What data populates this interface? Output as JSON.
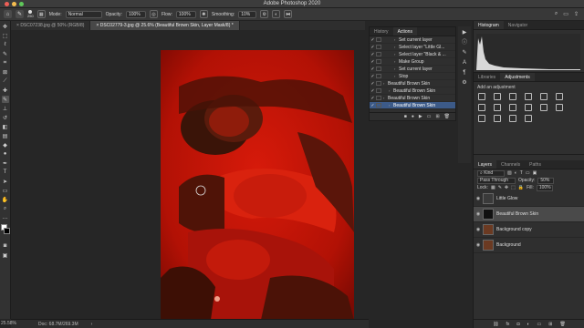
{
  "app": {
    "title": "Adobe Photoshop 2020"
  },
  "options": {
    "mode_label": "Mode:",
    "mode_value": "Normal",
    "opacity_label": "Opacity:",
    "opacity_value": "100%",
    "flow_label": "Flow:",
    "flow_value": "100%",
    "smoothing_label": "Smoothing:",
    "smoothing_value": "10%",
    "brush_size": "250"
  },
  "tabs": [
    {
      "label": "DSC07238.jpg @ 50% (RGB/8)"
    },
    {
      "label": "DSC02779-3.jpg @ 25.6% (Beautiful Brown Skin, Layer Mask/8) *"
    }
  ],
  "actions_panel": {
    "tabs": [
      "History",
      "Actions"
    ],
    "rows": [
      {
        "label": "Set current layer",
        "indent": 2,
        "selected": false
      },
      {
        "label": "Select layer \"Little Gl...",
        "indent": 2,
        "selected": false
      },
      {
        "label": "Select layer \"Black & ...",
        "indent": 2,
        "selected": false
      },
      {
        "label": "Make Group",
        "indent": 2,
        "selected": false
      },
      {
        "label": "Set current layer",
        "indent": 2,
        "selected": false
      },
      {
        "label": "Stop",
        "indent": 2,
        "selected": false
      },
      {
        "label": "Beautiful Brown Skin",
        "indent": 0,
        "selected": false
      },
      {
        "label": "Beautiful Brown Skin",
        "indent": 1,
        "selected": false
      },
      {
        "label": "Beautiful Brown Skin",
        "indent": 0,
        "selected": false
      },
      {
        "label": "Beautiful Brown Skin",
        "indent": 1,
        "selected": true
      }
    ]
  },
  "histogram_panel": {
    "tabs": [
      "Histogram",
      "Navigator"
    ]
  },
  "adjust_panel": {
    "tabs": [
      "Libraries",
      "Adjustments"
    ],
    "add_label": "Add an adjustment"
  },
  "layers_panel": {
    "tabs": [
      "Layers",
      "Channels",
      "Paths"
    ],
    "kind": "Kind",
    "blend": "Pass Through",
    "opacity_label": "Opacity:",
    "opacity_value": "50%",
    "lock_label": "Lock:",
    "fill_label": "Fill:",
    "fill_value": "100%",
    "layers": [
      {
        "name": "Little Glow",
        "selected": false,
        "color": "#3a3a3a"
      },
      {
        "name": "Beautiful Brown Skin",
        "selected": true,
        "color": "#111111"
      },
      {
        "name": "Background copy",
        "selected": false,
        "color": "#6b3a22"
      },
      {
        "name": "Background",
        "selected": false,
        "color": "#6b3a22"
      }
    ]
  },
  "status": {
    "zoom": "25.58%",
    "doc": "Doc: 68.7M/269.3M"
  },
  "colors": {
    "accent": "#3c5a88",
    "image_red": "#b31105"
  }
}
